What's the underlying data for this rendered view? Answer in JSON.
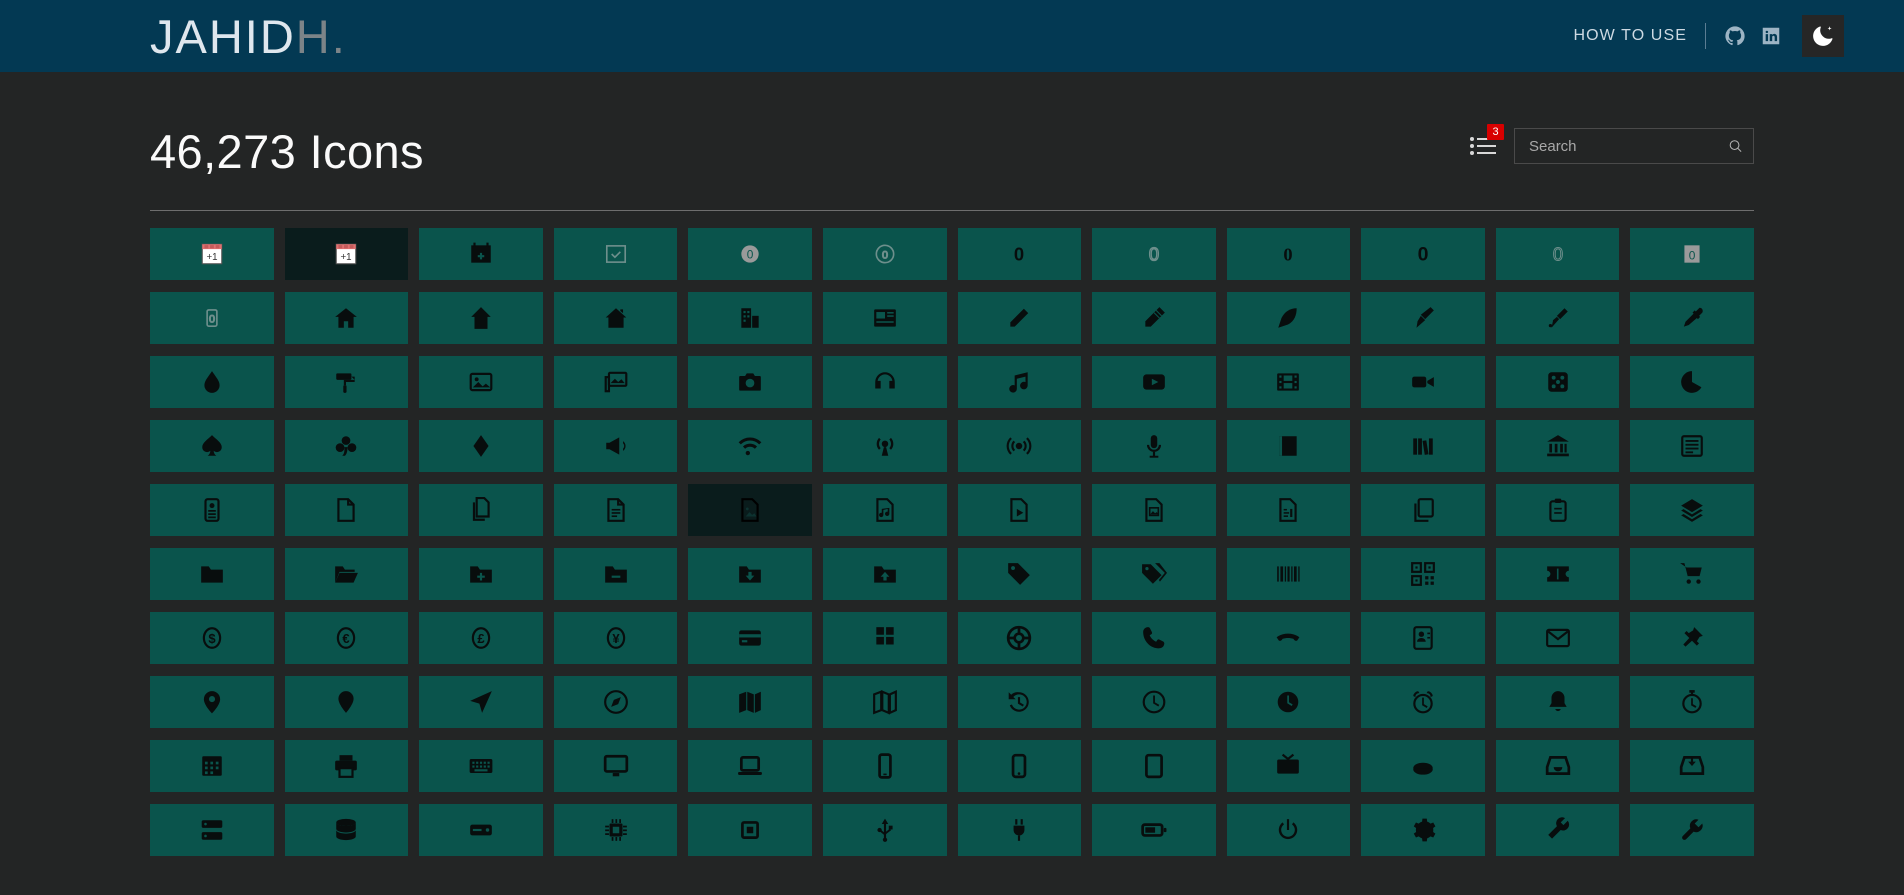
{
  "header": {
    "logo_light": "JAHID",
    "logo_gray": "H.",
    "how_to_use": "HOW TO USE",
    "github_icon": "github-icon",
    "linkedin_icon": "linkedin-icon",
    "theme_toggle_icon": "moon-icon"
  },
  "main": {
    "title": "46,273 Icons",
    "list_icon": "list-view-icon",
    "badge_count": "3",
    "search": {
      "placeholder": "Search",
      "value": "",
      "icon": "search-icon"
    }
  },
  "grid": {
    "columns": 12,
    "tile_color": "#0a544c",
    "tile_hover_color": "#0a1c1c",
    "icon_color": "#080d0d",
    "cells": [
      {
        "name": "calendar-plus-color-icon",
        "style": "color",
        "hover": false
      },
      {
        "name": "calendar-plus-color-icon",
        "style": "color",
        "hover": true
      },
      {
        "name": "calendar-plus-solid-icon",
        "style": "solid",
        "hover": false
      },
      {
        "name": "calendar-check-outline-icon",
        "style": "outline",
        "hover": false
      },
      {
        "name": "zero-circle-gray-icon",
        "style": "gray",
        "hover": false
      },
      {
        "name": "zero-circle-outline-icon",
        "style": "outline",
        "hover": false
      },
      {
        "name": "zero-bold-icon",
        "style": "solid",
        "hover": false
      },
      {
        "name": "zero-outline-icon",
        "style": "outline",
        "hover": false
      },
      {
        "name": "zero-serif-icon",
        "style": "solid",
        "hover": false
      },
      {
        "name": "zero-heavy-icon",
        "style": "solid",
        "hover": false
      },
      {
        "name": "zero-thin-icon",
        "style": "outline",
        "hover": false
      },
      {
        "name": "zero-box-gray-icon",
        "style": "gray",
        "hover": false
      },
      {
        "name": "zero-box-outline-icon",
        "style": "outline",
        "hover": false
      },
      {
        "name": "home-icon",
        "style": "solid",
        "hover": false
      },
      {
        "name": "home-alt-icon",
        "style": "solid",
        "hover": false
      },
      {
        "name": "home-chimney-icon",
        "style": "solid",
        "hover": false
      },
      {
        "name": "building-icon",
        "style": "solid",
        "hover": false
      },
      {
        "name": "newspaper-icon",
        "style": "solid",
        "hover": false
      },
      {
        "name": "pencil-icon",
        "style": "solid",
        "hover": false
      },
      {
        "name": "pen-icon",
        "style": "solid",
        "hover": false
      },
      {
        "name": "feather-icon",
        "style": "solid",
        "hover": false
      },
      {
        "name": "ink-pen-icon",
        "style": "solid",
        "hover": false
      },
      {
        "name": "fountain-pen-icon",
        "style": "solid",
        "hover": false
      },
      {
        "name": "eyedropper-icon",
        "style": "solid",
        "hover": false
      },
      {
        "name": "droplet-icon",
        "style": "solid",
        "hover": false
      },
      {
        "name": "paint-roller-icon",
        "style": "solid",
        "hover": false
      },
      {
        "name": "image-icon",
        "style": "solid",
        "hover": false
      },
      {
        "name": "images-icon",
        "style": "solid",
        "hover": false
      },
      {
        "name": "camera-icon",
        "style": "solid",
        "hover": false
      },
      {
        "name": "headphones-icon",
        "style": "solid",
        "hover": false
      },
      {
        "name": "music-note-icon",
        "style": "solid",
        "hover": false
      },
      {
        "name": "video-player-icon",
        "style": "solid",
        "hover": false
      },
      {
        "name": "film-icon",
        "style": "solid",
        "hover": false
      },
      {
        "name": "video-camera-icon",
        "style": "solid",
        "hover": false
      },
      {
        "name": "dice-icon",
        "style": "solid",
        "hover": false
      },
      {
        "name": "pacman-icon",
        "style": "solid",
        "hover": false
      },
      {
        "name": "spade-icon",
        "style": "solid",
        "hover": false
      },
      {
        "name": "club-icon",
        "style": "solid",
        "hover": false
      },
      {
        "name": "diamond-icon",
        "style": "solid",
        "hover": false
      },
      {
        "name": "megaphone-icon",
        "style": "solid",
        "hover": false
      },
      {
        "name": "wifi-icon",
        "style": "solid",
        "hover": false
      },
      {
        "name": "broadcast-icon",
        "style": "solid",
        "hover": false
      },
      {
        "name": "signal-icon",
        "style": "solid",
        "hover": false
      },
      {
        "name": "microphone-icon",
        "style": "solid",
        "hover": false
      },
      {
        "name": "book-icon",
        "style": "solid",
        "hover": false
      },
      {
        "name": "library-icon",
        "style": "solid",
        "hover": false
      },
      {
        "name": "bank-icon",
        "style": "solid",
        "hover": false
      },
      {
        "name": "article-icon",
        "style": "solid",
        "hover": false
      },
      {
        "name": "id-card-icon",
        "style": "solid",
        "hover": false
      },
      {
        "name": "file-icon",
        "style": "solid",
        "hover": false
      },
      {
        "name": "file-copy-icon",
        "style": "solid",
        "hover": false
      },
      {
        "name": "file-text-icon",
        "style": "solid",
        "hover": false
      },
      {
        "name": "file-image-icon",
        "style": "solid",
        "hover": true
      },
      {
        "name": "file-audio-icon",
        "style": "solid",
        "hover": false
      },
      {
        "name": "file-video-icon",
        "style": "solid",
        "hover": false
      },
      {
        "name": "file-picture-icon",
        "style": "solid",
        "hover": false
      },
      {
        "name": "file-code-icon",
        "style": "solid",
        "hover": false
      },
      {
        "name": "copy-icon",
        "style": "solid",
        "hover": false
      },
      {
        "name": "clipboard-icon",
        "style": "solid",
        "hover": false
      },
      {
        "name": "layers-icon",
        "style": "solid",
        "hover": false
      },
      {
        "name": "folder-icon",
        "style": "solid",
        "hover": false
      },
      {
        "name": "folder-open-icon",
        "style": "solid",
        "hover": false
      },
      {
        "name": "folder-plus-icon",
        "style": "solid",
        "hover": false
      },
      {
        "name": "folder-minus-icon",
        "style": "solid",
        "hover": false
      },
      {
        "name": "folder-download-icon",
        "style": "solid",
        "hover": false
      },
      {
        "name": "folder-upload-icon",
        "style": "solid",
        "hover": false
      },
      {
        "name": "tag-icon",
        "style": "solid",
        "hover": false
      },
      {
        "name": "tags-icon",
        "style": "solid",
        "hover": false
      },
      {
        "name": "barcode-icon",
        "style": "solid",
        "hover": false
      },
      {
        "name": "qr-code-icon",
        "style": "solid",
        "hover": false
      },
      {
        "name": "ticket-icon",
        "style": "solid",
        "hover": false
      },
      {
        "name": "shopping-cart-icon",
        "style": "solid",
        "hover": false
      },
      {
        "name": "dollar-circle-icon",
        "style": "solid",
        "hover": false
      },
      {
        "name": "euro-circle-icon",
        "style": "solid",
        "hover": false
      },
      {
        "name": "pound-circle-icon",
        "style": "solid",
        "hover": false
      },
      {
        "name": "yen-circle-icon",
        "style": "solid",
        "hover": false
      },
      {
        "name": "credit-card-icon",
        "style": "solid",
        "hover": false
      },
      {
        "name": "calculator-icon",
        "style": "solid",
        "hover": false
      },
      {
        "name": "lifebuoy-icon",
        "style": "solid",
        "hover": false
      },
      {
        "name": "phone-icon",
        "style": "solid",
        "hover": false
      },
      {
        "name": "phone-hangup-icon",
        "style": "solid",
        "hover": false
      },
      {
        "name": "contact-card-icon",
        "style": "solid",
        "hover": false
      },
      {
        "name": "envelope-icon",
        "style": "solid",
        "hover": false
      },
      {
        "name": "pushpin-icon",
        "style": "solid",
        "hover": false
      },
      {
        "name": "map-pin-icon",
        "style": "solid",
        "hover": false
      },
      {
        "name": "location-marker-icon",
        "style": "solid",
        "hover": false
      },
      {
        "name": "navigation-icon",
        "style": "solid",
        "hover": false
      },
      {
        "name": "compass-icon",
        "style": "solid",
        "hover": false
      },
      {
        "name": "map-icon",
        "style": "solid",
        "hover": false
      },
      {
        "name": "map-folded-icon",
        "style": "solid",
        "hover": false
      },
      {
        "name": "history-icon",
        "style": "solid",
        "hover": false
      },
      {
        "name": "clock-outline-icon",
        "style": "solid",
        "hover": false
      },
      {
        "name": "clock-solid-icon",
        "style": "solid",
        "hover": false
      },
      {
        "name": "alarm-clock-icon",
        "style": "solid",
        "hover": false
      },
      {
        "name": "bell-icon",
        "style": "solid",
        "hover": false
      },
      {
        "name": "stopwatch-icon",
        "style": "solid",
        "hover": false
      },
      {
        "name": "calendar-icon",
        "style": "solid",
        "hover": false
      },
      {
        "name": "printer-icon",
        "style": "solid",
        "hover": false
      },
      {
        "name": "keyboard-icon",
        "style": "solid",
        "hover": false
      },
      {
        "name": "desktop-icon",
        "style": "solid",
        "hover": false
      },
      {
        "name": "laptop-icon",
        "style": "solid",
        "hover": false
      },
      {
        "name": "mobile-icon",
        "style": "solid",
        "hover": false
      },
      {
        "name": "smartphone-icon",
        "style": "solid",
        "hover": false
      },
      {
        "name": "tablet-icon",
        "style": "solid",
        "hover": false
      },
      {
        "name": "tv-icon",
        "style": "solid",
        "hover": false
      },
      {
        "name": "mouse-icon",
        "style": "solid",
        "hover": false
      },
      {
        "name": "inbox-icon",
        "style": "solid",
        "hover": false
      },
      {
        "name": "inbox-download-icon",
        "style": "solid",
        "hover": false
      },
      {
        "name": "server-icon",
        "style": "solid",
        "hover": false
      },
      {
        "name": "database-icon",
        "style": "solid",
        "hover": false
      },
      {
        "name": "hard-drive-icon",
        "style": "solid",
        "hover": false
      },
      {
        "name": "cpu-icon",
        "style": "solid",
        "hover": false
      },
      {
        "name": "chip-icon",
        "style": "solid",
        "hover": false
      },
      {
        "name": "usb-icon",
        "style": "solid",
        "hover": false
      },
      {
        "name": "plug-icon",
        "style": "solid",
        "hover": false
      },
      {
        "name": "battery-icon",
        "style": "solid",
        "hover": false
      },
      {
        "name": "power-icon",
        "style": "solid",
        "hover": false
      },
      {
        "name": "settings-icon",
        "style": "solid",
        "hover": false
      },
      {
        "name": "tools-icon",
        "style": "solid",
        "hover": false
      },
      {
        "name": "wrench-icon",
        "style": "solid",
        "hover": false
      }
    ]
  }
}
